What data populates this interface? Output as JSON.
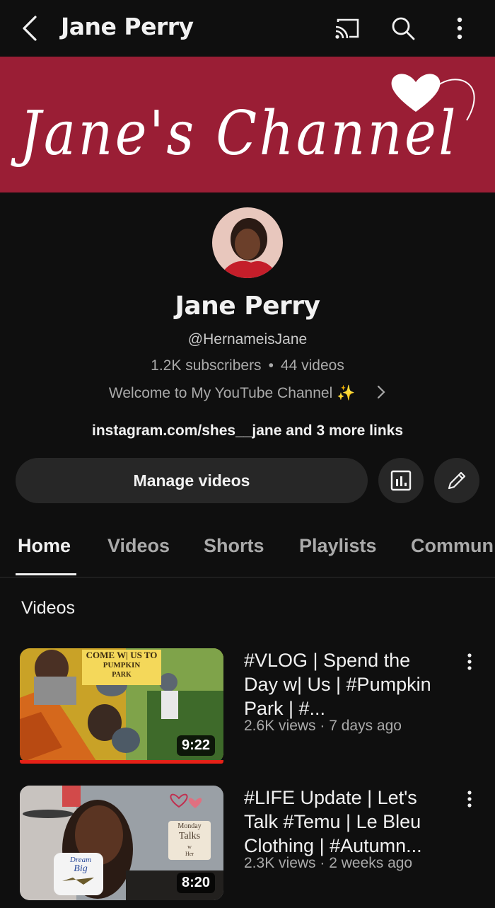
{
  "header": {
    "title": "Jane Perry",
    "icons": [
      "back-arrow-icon",
      "cast-icon",
      "search-icon",
      "more-vertical-icon"
    ]
  },
  "banner": {
    "script_text": "Jane's Channel",
    "background_color": "#9a1e35",
    "accent_icon": "heart-icon"
  },
  "profile": {
    "name": "Jane Perry",
    "handle": "@HernameisJane",
    "subscribers": "1.2K subscribers",
    "separator": "•",
    "videos_count": "44 videos",
    "description": "Welcome to My YouTube Channel ✨",
    "links": "instagram.com/shes__jane and 3 more links"
  },
  "actions": {
    "manage_label": "Manage videos",
    "analytics_icon": "analytics-icon",
    "edit_icon": "pencil-icon"
  },
  "tabs": [
    {
      "label": "Home",
      "active": true
    },
    {
      "label": "Videos",
      "active": false
    },
    {
      "label": "Shorts",
      "active": false
    },
    {
      "label": "Playlists",
      "active": false
    },
    {
      "label": "Commun",
      "active": false
    }
  ],
  "section": {
    "title": "Videos"
  },
  "videos": [
    {
      "title": "#VLOG | Spend the Day w| Us | #Pumpkin Park | #...",
      "meta": "2.6K views · 7 days ago",
      "duration": "9:22",
      "thumb_text": "COME W| US TO PUMPKIN PARK",
      "thumb_line1": "COME W| US TO",
      "thumb_line2": "PUMPKIN",
      "thumb_line3": "PARK"
    },
    {
      "title": "#LIFE Update | Let's Talk #Temu | Le Bleu Clothing | #Autumn...",
      "meta": "2.3K views · 2 weeks ago",
      "duration": "8:20",
      "sign_line1": "Monday",
      "sign_line2": "Talks",
      "sign_line3": "w",
      "sign_line4": "Her",
      "mug_line1": "Dream",
      "mug_line2": "Big"
    }
  ],
  "colors": {
    "background": "#0f0f0f",
    "button": "#272727",
    "progress": "#e62117",
    "secondary_text": "#aaaaaa"
  }
}
